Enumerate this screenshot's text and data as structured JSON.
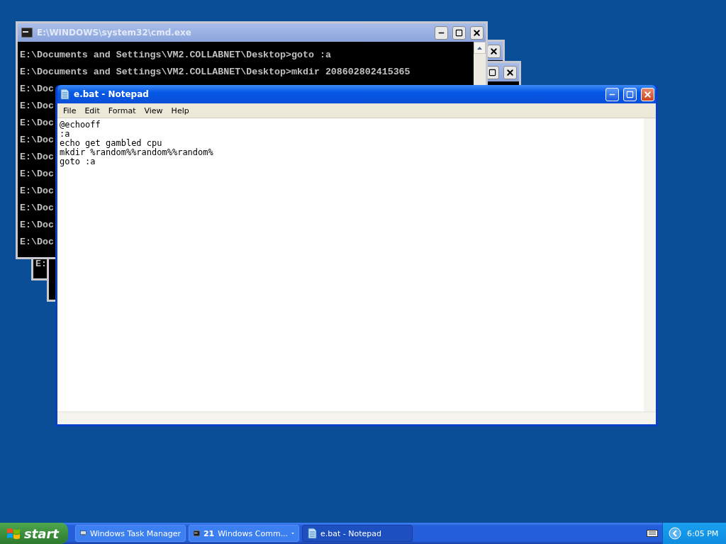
{
  "back_windows": [
    {
      "kind": "console",
      "text": "E:"
    },
    {
      "kind": "console"
    }
  ],
  "console": {
    "title": "E:\\WINDOWS\\system32\\cmd.exe",
    "active": false,
    "lines": [
      "E:\\Documents and Settings\\VM2.COLLABNET\\Desktop>goto :a",
      "E:\\Documents and Settings\\VM2.COLLABNET\\Desktop>mkdir 208602802415365",
      "E:\\Doc",
      "E:\\Doc",
      "E:\\Doc",
      "E:\\Doc",
      "E:\\Doc",
      "E:\\Doc",
      "E:\\Doc",
      "E:\\Doc",
      "E:\\Doc",
      "E:\\Doc"
    ]
  },
  "notepad": {
    "title": "e.bat - Notepad",
    "active": true,
    "menu": [
      "File",
      "Edit",
      "Format",
      "View",
      "Help"
    ],
    "lines": [
      "@echooff",
      ":a",
      "echo get gambled cpu",
      "mkdir %random%%random%%random%",
      "goto :a"
    ]
  },
  "taskbar": {
    "start": "start",
    "tasks": [
      {
        "kind": "monitor",
        "label": "Windows Task Manager",
        "selected": false
      },
      {
        "kind": "console-group",
        "count": "21",
        "label": "Windows Comm...",
        "selected": false
      },
      {
        "kind": "notepad",
        "label": "e.bat - Notepad",
        "selected": true
      }
    ],
    "clock": "6:05 PM"
  }
}
